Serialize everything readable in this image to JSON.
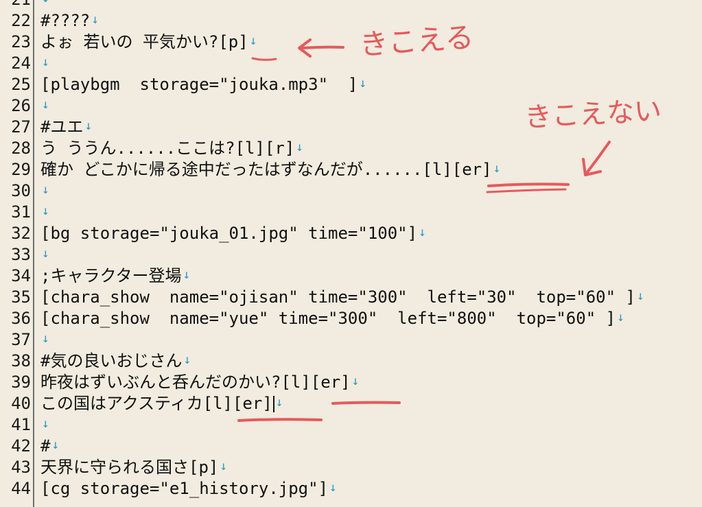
{
  "editor": {
    "lines": [
      {
        "n": "21",
        "code": ""
      },
      {
        "n": "22",
        "code": "#????"
      },
      {
        "n": "23",
        "code": "よぉ 若いの 平気かい?[p]"
      },
      {
        "n": "24",
        "code": ""
      },
      {
        "n": "25",
        "code": "[playbgm  storage=\"jouka.mp3\"  ]"
      },
      {
        "n": "26",
        "code": ""
      },
      {
        "n": "27",
        "code": "#ユエ"
      },
      {
        "n": "28",
        "code": "う ううん......ここは?[l][r]"
      },
      {
        "n": "29",
        "code": "確か どこかに帰る途中だったはずなんだが......[l][er]"
      },
      {
        "n": "30",
        "code": ""
      },
      {
        "n": "31",
        "code": ""
      },
      {
        "n": "32",
        "code": "[bg storage=\"jouka_01.jpg\" time=\"100\"]"
      },
      {
        "n": "33",
        "code": ""
      },
      {
        "n": "34",
        "code": ";キャラクター登場"
      },
      {
        "n": "35",
        "code": "[chara_show  name=\"ojisan\" time=\"300\"  left=\"30\"  top=\"60\" ]"
      },
      {
        "n": "36",
        "code": "[chara_show  name=\"yue\" time=\"300\"  left=\"800\"  top=\"60\" ]"
      },
      {
        "n": "37",
        "code": ""
      },
      {
        "n": "38",
        "code": "#気の良いおじさん"
      },
      {
        "n": "39",
        "code": "昨夜はずいぶんと呑んだのかい?[l][er]"
      },
      {
        "n": "40",
        "code": "この国はアクスティカ[l][er]"
      },
      {
        "n": "41",
        "code": ""
      },
      {
        "n": "42",
        "code": "#"
      },
      {
        "n": "43",
        "code": "天界に守られる国さ[p]"
      },
      {
        "n": "44",
        "code": "[cg storage=\"e1_history.jpg\"]"
      }
    ],
    "newline_glyph": "↓",
    "caret_line": "40"
  },
  "annotations": {
    "audible_label": "きこえる",
    "inaudible_label": "きこえない",
    "color": "#e8595c"
  }
}
